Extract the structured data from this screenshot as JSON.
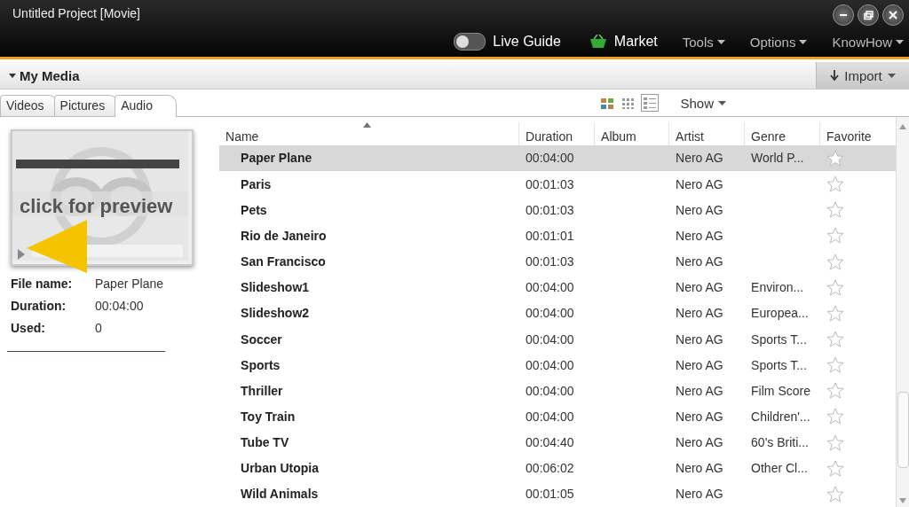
{
  "window": {
    "title": "Untitled Project [Movie]"
  },
  "nav": {
    "live_guide": {
      "label": "Live Guide",
      "on": false
    },
    "market": {
      "label": "Market"
    },
    "menus": [
      "Tools",
      "Options",
      "KnowHow"
    ]
  },
  "panel": {
    "title": "My Media",
    "import_button": "Import"
  },
  "tabs": [
    {
      "label": "Videos",
      "selected": false
    },
    {
      "label": "Pictures",
      "selected": false
    },
    {
      "label": "Audio",
      "selected": true
    }
  ],
  "view_modes": [
    {
      "kind": "thumbs",
      "selected": false
    },
    {
      "kind": "grid",
      "selected": false
    },
    {
      "kind": "details",
      "selected": true
    }
  ],
  "show_menu": "Show",
  "preview": {
    "overlay_text": "click for preview",
    "details": [
      {
        "label": "File name:",
        "value": "Paper Plane"
      },
      {
        "label": "Duration:",
        "value": "00:04:00"
      },
      {
        "label": "Used:",
        "value": "0"
      }
    ]
  },
  "table": {
    "columns": [
      "Name",
      "Duration",
      "Album",
      "Artist",
      "Genre",
      "Favorite"
    ],
    "rows": [
      {
        "name": "Paper Plane",
        "duration": "00:04:00",
        "artist": "Nero AG",
        "genre": "World P...",
        "favorite": false,
        "selected": true
      },
      {
        "name": "Paris",
        "duration": "00:01:03",
        "artist": "Nero AG",
        "favorite": false,
        "selected": false
      },
      {
        "name": "Pets",
        "duration": "00:01:03",
        "artist": "Nero AG",
        "favorite": false,
        "selected": false
      },
      {
        "name": "Rio de Janeiro",
        "duration": "00:01:01",
        "artist": "Nero AG",
        "favorite": false,
        "selected": false
      },
      {
        "name": "San Francisco",
        "duration": "00:01:03",
        "artist": "Nero AG",
        "favorite": false,
        "selected": false
      },
      {
        "name": "Slideshow1",
        "duration": "00:04:00",
        "artist": "Nero AG",
        "genre": "Environ...",
        "favorite": false,
        "selected": false
      },
      {
        "name": "Slideshow2",
        "duration": "00:04:00",
        "artist": "Nero AG",
        "genre": "Europea...",
        "favorite": false,
        "selected": false
      },
      {
        "name": "Soccer",
        "duration": "00:04:00",
        "artist": "Nero AG",
        "genre": "Sports T...",
        "favorite": false,
        "selected": false
      },
      {
        "name": "Sports",
        "duration": "00:04:00",
        "artist": "Nero AG",
        "genre": "Sports T...",
        "favorite": false,
        "selected": false
      },
      {
        "name": "Thriller",
        "duration": "00:04:00",
        "artist": "Nero AG",
        "genre": "Film Score",
        "favorite": false,
        "selected": false
      },
      {
        "name": "Toy Train",
        "duration": "00:04:00",
        "artist": "Nero AG",
        "genre": "Children'...",
        "favorite": false,
        "selected": false
      },
      {
        "name": "Tube TV",
        "duration": "00:04:40",
        "artist": "Nero AG",
        "genre": "60's Briti...",
        "favorite": false,
        "selected": false
      },
      {
        "name": "Urban Utopia",
        "duration": "00:06:02",
        "artist": "Nero AG",
        "genre": "Other Cl...",
        "favorite": false,
        "selected": false
      },
      {
        "name": "Wild Animals",
        "duration": "00:01:05",
        "artist": "Nero AG",
        "favorite": false,
        "selected": false
      }
    ]
  }
}
